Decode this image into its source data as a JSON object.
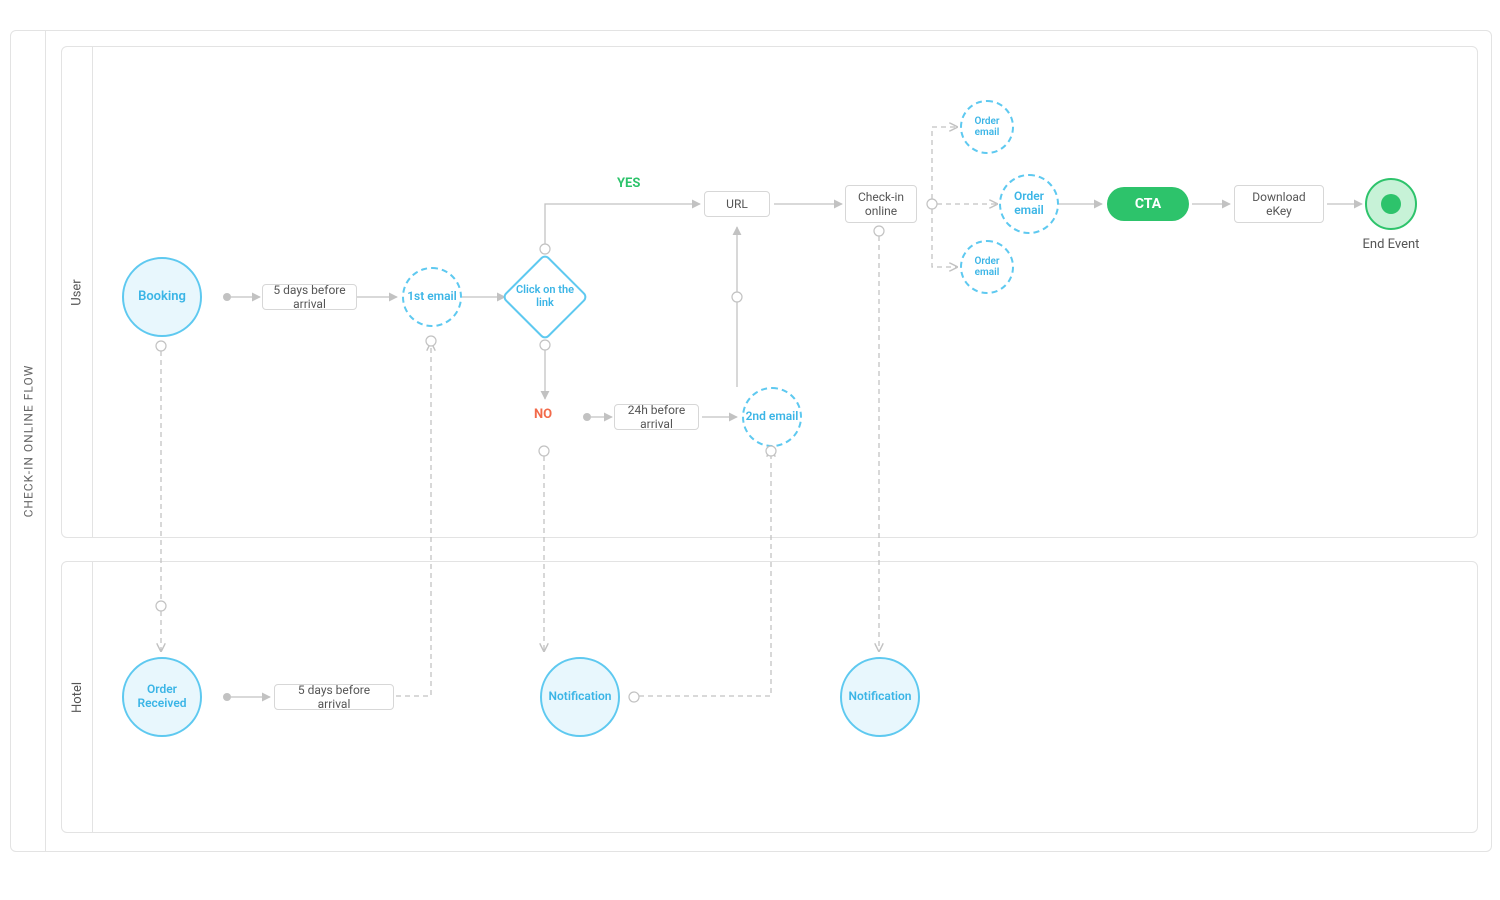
{
  "pool_title": "CHECK-IN ONLINE FLOW",
  "lanes": {
    "user": "User",
    "hotel": "Hotel"
  },
  "nodes": {
    "booking": "Booking",
    "five_days": "5 days before arrival",
    "email1": "1st email",
    "click": "Click on the link",
    "yes": "YES",
    "no": "NO",
    "twentyfour": "24h before arrival",
    "email2": "2nd email",
    "url": "URL",
    "checkin": "Check-in online",
    "order1": "Order email",
    "order2": "Order email",
    "order3": "Order email",
    "cta": "CTA",
    "download": "Download eKey",
    "end": "End Event",
    "order_received": "Order Received",
    "five_days_hotel": "5 days before arrival",
    "notification1": "Notification",
    "notification2": "Notification"
  },
  "chart_data": {
    "type": "bpmn-swimlane-flowchart",
    "title": "CHECK-IN ONLINE FLOW",
    "lanes": [
      "User",
      "Hotel"
    ],
    "nodes": [
      {
        "id": "booking",
        "lane": "User",
        "type": "start-event",
        "label": "Booking"
      },
      {
        "id": "five_days",
        "lane": "User",
        "type": "task",
        "label": "5 days before arrival"
      },
      {
        "id": "email1",
        "lane": "User",
        "type": "message-event",
        "label": "1st email"
      },
      {
        "id": "click",
        "lane": "User",
        "type": "gateway",
        "label": "Click on the link"
      },
      {
        "id": "twentyfour",
        "lane": "User",
        "type": "task",
        "label": "24h before arrival"
      },
      {
        "id": "email2",
        "lane": "User",
        "type": "message-event",
        "label": "2nd email"
      },
      {
        "id": "url",
        "lane": "User",
        "type": "task",
        "label": "URL"
      },
      {
        "id": "checkin",
        "lane": "User",
        "type": "task",
        "label": "Check-in online"
      },
      {
        "id": "order1",
        "lane": "User",
        "type": "message-event",
        "label": "Order email"
      },
      {
        "id": "order2",
        "lane": "User",
        "type": "message-event",
        "label": "Order email"
      },
      {
        "id": "order3",
        "lane": "User",
        "type": "message-event",
        "label": "Order email"
      },
      {
        "id": "cta",
        "lane": "User",
        "type": "call-to-action",
        "label": "CTA"
      },
      {
        "id": "download",
        "lane": "User",
        "type": "task",
        "label": "Download eKey"
      },
      {
        "id": "end",
        "lane": "User",
        "type": "end-event",
        "label": "End Event"
      },
      {
        "id": "order_received",
        "lane": "Hotel",
        "type": "start-event",
        "label": "Order Received"
      },
      {
        "id": "five_days_hotel",
        "lane": "Hotel",
        "type": "task",
        "label": "5 days before arrival"
      },
      {
        "id": "notification1",
        "lane": "Hotel",
        "type": "message-event",
        "label": "Notification"
      },
      {
        "id": "notification2",
        "lane": "Hotel",
        "type": "message-event",
        "label": "Notification"
      }
    ],
    "edges": [
      {
        "from": "booking",
        "to": "five_days",
        "style": "solid"
      },
      {
        "from": "five_days",
        "to": "email1",
        "style": "solid"
      },
      {
        "from": "email1",
        "to": "click",
        "style": "solid"
      },
      {
        "from": "click",
        "to": "url",
        "label": "YES",
        "style": "solid"
      },
      {
        "from": "click",
        "to": "twentyfour",
        "label": "NO",
        "style": "solid"
      },
      {
        "from": "twentyfour",
        "to": "email2",
        "style": "solid"
      },
      {
        "from": "email2",
        "to": "url",
        "style": "solid"
      },
      {
        "from": "url",
        "to": "checkin",
        "style": "solid"
      },
      {
        "from": "checkin",
        "to": "order1",
        "style": "dashed"
      },
      {
        "from": "checkin",
        "to": "order2",
        "style": "dashed"
      },
      {
        "from": "checkin",
        "to": "order3",
        "style": "dashed"
      },
      {
        "from": "order2",
        "to": "cta",
        "style": "solid"
      },
      {
        "from": "cta",
        "to": "download",
        "style": "solid"
      },
      {
        "from": "download",
        "to": "end",
        "style": "solid"
      },
      {
        "from": "booking",
        "to": "order_received",
        "style": "dashed",
        "type": "message"
      },
      {
        "from": "order_received",
        "to": "five_days_hotel",
        "style": "solid"
      },
      {
        "from": "five_days_hotel",
        "to": "email1",
        "style": "dashed",
        "type": "message"
      },
      {
        "from": "click",
        "to": "notification1",
        "style": "dashed",
        "type": "message"
      },
      {
        "from": "notification1",
        "to": "email2",
        "style": "dashed",
        "type": "message"
      },
      {
        "from": "checkin",
        "to": "notification2",
        "style": "dashed",
        "type": "message"
      }
    ]
  }
}
